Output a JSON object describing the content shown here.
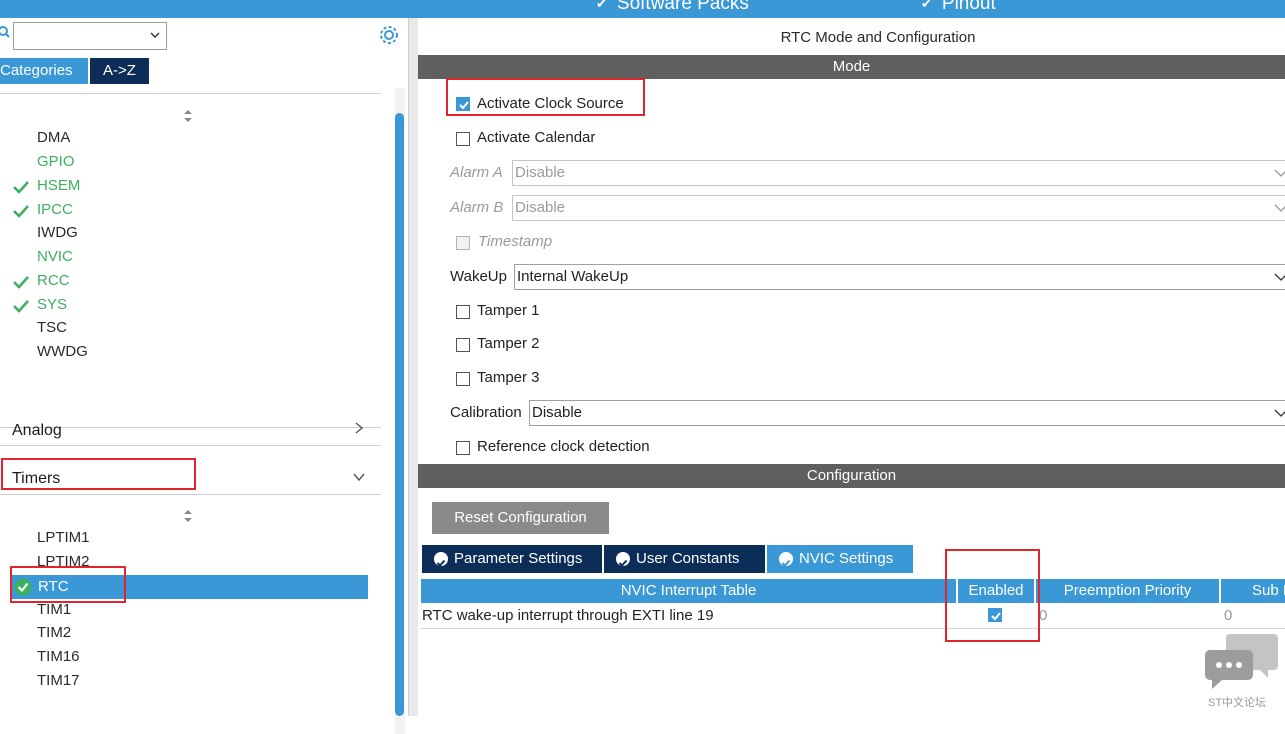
{
  "topbar": {
    "software_packs": "Software Packs",
    "pinout": "Pinout"
  },
  "left": {
    "tabs": {
      "categories": "Categories",
      "a_to_z": "A->Z"
    },
    "system_core_items": [
      {
        "label": "DMA",
        "state": "none"
      },
      {
        "label": "GPIO",
        "state": "configured"
      },
      {
        "label": "HSEM",
        "state": "checked"
      },
      {
        "label": "IPCC",
        "state": "checked"
      },
      {
        "label": "IWDG",
        "state": "none"
      },
      {
        "label": "NVIC",
        "state": "configured"
      },
      {
        "label": "RCC",
        "state": "checked"
      },
      {
        "label": "SYS",
        "state": "checked"
      },
      {
        "label": "TSC",
        "state": "none"
      },
      {
        "label": "WWDG",
        "state": "none"
      }
    ],
    "sections": {
      "analog": "Analog",
      "timers": "Timers"
    },
    "timers_items": [
      {
        "label": "LPTIM1"
      },
      {
        "label": "LPTIM2"
      },
      {
        "label": "RTC",
        "selected": true
      },
      {
        "label": "TIM1"
      },
      {
        "label": "TIM2"
      },
      {
        "label": "TIM16"
      },
      {
        "label": "TIM17"
      }
    ]
  },
  "right": {
    "title": "RTC Mode and Configuration",
    "mode_header": "Mode",
    "activate_clock_source": {
      "label": "Activate Clock Source",
      "checked": true
    },
    "activate_calendar": {
      "label": "Activate Calendar",
      "checked": false
    },
    "alarm_a": {
      "label": "Alarm A",
      "value": "Disable"
    },
    "alarm_b": {
      "label": "Alarm B",
      "value": "Disable"
    },
    "timestamp": {
      "label": "Timestamp"
    },
    "wakeup": {
      "label": "WakeUp",
      "value": "Internal WakeUp"
    },
    "tamper1": {
      "label": "Tamper 1"
    },
    "tamper2": {
      "label": "Tamper 2"
    },
    "tamper3": {
      "label": "Tamper 3"
    },
    "calibration": {
      "label": "Calibration",
      "value": "Disable"
    },
    "reference_clock": {
      "label": "Reference clock detection"
    },
    "configuration_header": "Configuration",
    "reset_button": "Reset Configuration",
    "tabs": {
      "parameter_settings": "Parameter Settings",
      "user_constants": "User Constants",
      "nvic_settings": "NVIC Settings"
    },
    "nvic_table": {
      "headers": [
        "NVIC Interrupt Table",
        "Enabled",
        "Preemption Priority",
        "Sub Pr"
      ],
      "row": {
        "name": "RTC wake-up interrupt through EXTI line 19",
        "enabled": true,
        "preemption": "0",
        "sub": "0"
      }
    }
  },
  "watermark": {
    "text": "ST中文论坛"
  },
  "colors": {
    "accent": "#3a98d6",
    "dark_tab": "#0c2d57",
    "green": "#3daf61",
    "highlight": "#e0252d"
  }
}
